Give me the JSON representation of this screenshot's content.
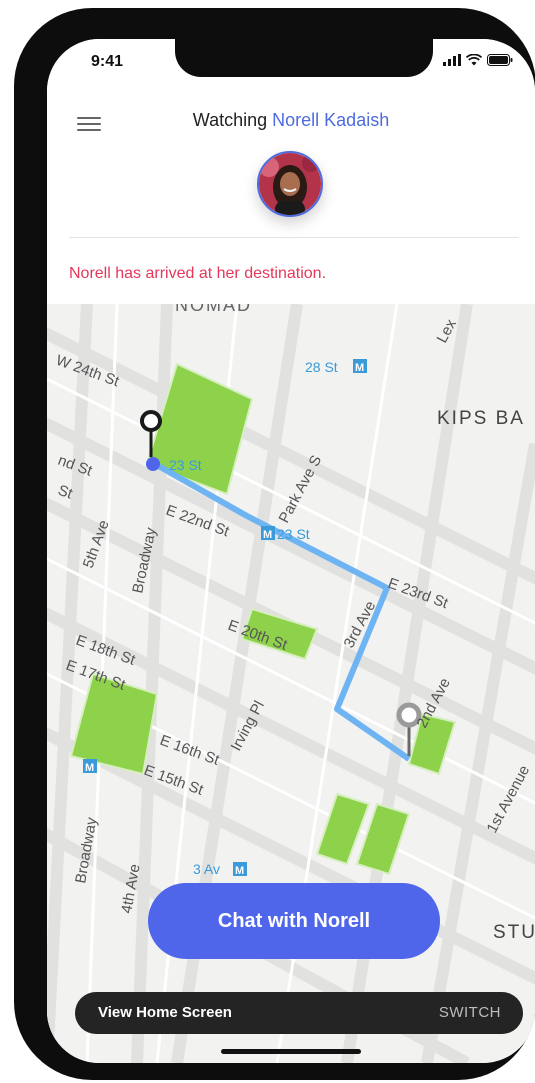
{
  "status_bar": {
    "time": "9:41"
  },
  "header": {
    "watching_prefix": "Watching",
    "watched_name": "Norell Kadaish",
    "arrival_message": "Norell has arrived at her destination."
  },
  "map": {
    "neighborhoods": [
      "NOMAD",
      "KIPS BA",
      "STU"
    ],
    "streets": [
      "W 24th St",
      "nd St",
      "St",
      "5th Ave",
      "Broadway",
      "E 22nd St",
      "Park Ave S",
      "E 23rd St",
      "3rd Ave",
      "E 18th St",
      "E 17th St",
      "E 20th St",
      "Irving Pl",
      "E 16th St",
      "E 15th St",
      "2nd Ave",
      "1st Avenue",
      "Broadway",
      "4th Ave",
      "Lex"
    ],
    "stations": [
      {
        "name": "28 St",
        "icon": "M"
      },
      {
        "name": "23 St",
        "icon": "M"
      },
      {
        "name": "23 St",
        "icon": "M"
      },
      {
        "name": "3 Av",
        "icon": "M"
      }
    ],
    "route_color": "#6fb4f2"
  },
  "actions": {
    "chat_button": "Chat with Norell"
  },
  "bottom_bar": {
    "label": "View Home Screen",
    "action": "SWITCH"
  },
  "colors": {
    "accent": "#4f66eb",
    "alert": "#e3385a",
    "park": "#8ed14a"
  }
}
